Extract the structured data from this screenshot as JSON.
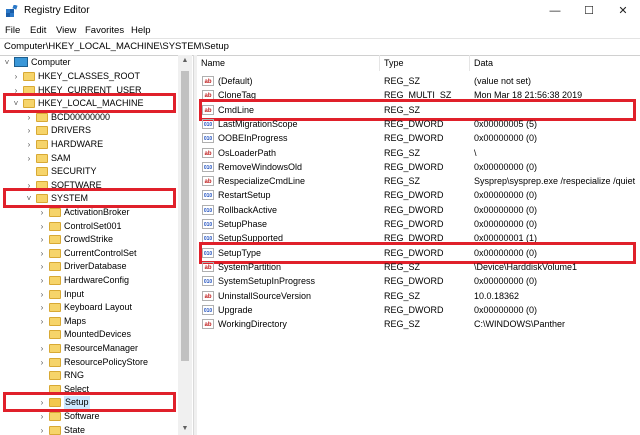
{
  "window": {
    "title": "Registry Editor",
    "minimize": "—",
    "maximize": "☐",
    "close": "✕"
  },
  "menu": [
    "File",
    "Edit",
    "View",
    "Favorites",
    "Help"
  ],
  "address": "Computer\\HKEY_LOCAL_MACHINE\\SYSTEM\\Setup",
  "tree": {
    "root": "Computer",
    "items": [
      {
        "label": "HKEY_CLASSES_ROOT",
        "level": 1,
        "expander": "›"
      },
      {
        "label": "HKEY_CURRENT_USER",
        "level": 1,
        "expander": "›"
      },
      {
        "label": "HKEY_LOCAL_MACHINE",
        "level": 1,
        "expander": "˅",
        "highlight": true
      },
      {
        "label": "BCD00000000",
        "level": 2,
        "expander": "›"
      },
      {
        "label": "DRIVERS",
        "level": 2,
        "expander": "›"
      },
      {
        "label": "HARDWARE",
        "level": 2,
        "expander": "›"
      },
      {
        "label": "SAM",
        "level": 2,
        "expander": "›"
      },
      {
        "label": "SECURITY",
        "level": 2,
        "expander": ""
      },
      {
        "label": "SOFTWARE",
        "level": 2,
        "expander": "›"
      },
      {
        "label": "SYSTEM",
        "level": 2,
        "expander": "˅",
        "highlight": true
      },
      {
        "label": "ActivationBroker",
        "level": 3,
        "expander": "›"
      },
      {
        "label": "ControlSet001",
        "level": 3,
        "expander": "›"
      },
      {
        "label": "CrowdStrike",
        "level": 3,
        "expander": "›"
      },
      {
        "label": "CurrentControlSet",
        "level": 3,
        "expander": "›"
      },
      {
        "label": "DriverDatabase",
        "level": 3,
        "expander": "›"
      },
      {
        "label": "HardwareConfig",
        "level": 3,
        "expander": "›"
      },
      {
        "label": "Input",
        "level": 3,
        "expander": "›"
      },
      {
        "label": "Keyboard Layout",
        "level": 3,
        "expander": "›"
      },
      {
        "label": "Maps",
        "level": 3,
        "expander": "›"
      },
      {
        "label": "MountedDevices",
        "level": 3,
        "expander": ""
      },
      {
        "label": "ResourceManager",
        "level": 3,
        "expander": "›"
      },
      {
        "label": "ResourcePolicyStore",
        "level": 3,
        "expander": "›"
      },
      {
        "label": "RNG",
        "level": 3,
        "expander": ""
      },
      {
        "label": "Select",
        "level": 3,
        "expander": ""
      },
      {
        "label": "Setup",
        "level": 3,
        "expander": "›",
        "selected": true,
        "highlight": true
      },
      {
        "label": "Software",
        "level": 3,
        "expander": "›"
      },
      {
        "label": "State",
        "level": 3,
        "expander": "›"
      }
    ]
  },
  "columns": {
    "name": "Name",
    "type": "Type",
    "data": "Data"
  },
  "values": [
    {
      "name": "(Default)",
      "type": "REG_SZ",
      "data": "(value not set)",
      "icon": "ab"
    },
    {
      "name": "CloneTag",
      "type": "REG_MULTI_SZ",
      "data": "Mon Mar 18 21:56:38 2019",
      "icon": "ab"
    },
    {
      "name": "CmdLine",
      "type": "REG_SZ",
      "data": "",
      "icon": "ab",
      "highlight": true
    },
    {
      "name": "LastMigrationScope",
      "type": "REG_DWORD",
      "data": "0x00000005 (5)",
      "icon": "bin"
    },
    {
      "name": "OOBEInProgress",
      "type": "REG_DWORD",
      "data": "0x00000000 (0)",
      "icon": "bin"
    },
    {
      "name": "OsLoaderPath",
      "type": "REG_SZ",
      "data": "\\",
      "icon": "ab"
    },
    {
      "name": "RemoveWindowsOld",
      "type": "REG_DWORD",
      "data": "0x00000000 (0)",
      "icon": "bin"
    },
    {
      "name": "RespecializeCmdLine",
      "type": "REG_SZ",
      "data": "Sysprep\\sysprep.exe /respecialize /quiet",
      "icon": "ab"
    },
    {
      "name": "RestartSetup",
      "type": "REG_DWORD",
      "data": "0x00000000 (0)",
      "icon": "bin"
    },
    {
      "name": "RollbackActive",
      "type": "REG_DWORD",
      "data": "0x00000000 (0)",
      "icon": "bin"
    },
    {
      "name": "SetupPhase",
      "type": "REG_DWORD",
      "data": "0x00000000 (0)",
      "icon": "bin"
    },
    {
      "name": "SetupSupported",
      "type": "REG_DWORD",
      "data": "0x00000001 (1)",
      "icon": "bin"
    },
    {
      "name": "SetupType",
      "type": "REG_DWORD",
      "data": "0x00000000 (0)",
      "icon": "bin",
      "highlight": true
    },
    {
      "name": "SystemPartition",
      "type": "REG_SZ",
      "data": "\\Device\\HarddiskVolume1",
      "icon": "ab"
    },
    {
      "name": "SystemSetupInProgress",
      "type": "REG_DWORD",
      "data": "0x00000000 (0)",
      "icon": "bin"
    },
    {
      "name": "UninstallSourceVersion",
      "type": "REG_SZ",
      "data": "10.0.18362",
      "icon": "ab"
    },
    {
      "name": "Upgrade",
      "type": "REG_DWORD",
      "data": "0x00000000 (0)",
      "icon": "bin"
    },
    {
      "name": "WorkingDirectory",
      "type": "REG_SZ",
      "data": "C:\\WINDOWS\\Panther",
      "icon": "ab"
    }
  ],
  "icon_labels": {
    "ab": "ab",
    "bin": "010"
  },
  "colors": {
    "highlight": "#e0202a",
    "folder": "#f6d46a",
    "selection": "#cce8ff"
  }
}
